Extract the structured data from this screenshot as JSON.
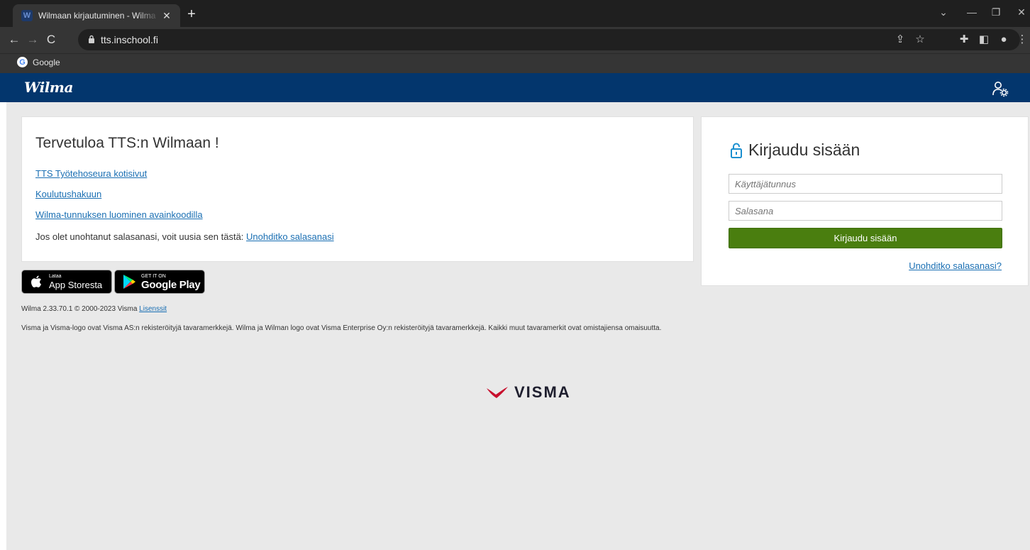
{
  "browser": {
    "tab_title": "Wilmaan kirjautuminen - Wilma",
    "tab_favicon": "W",
    "url": "tts.inschool.fi",
    "bookmark_label": "Google"
  },
  "wilma": {
    "logo": "Wilma",
    "header_color": "#03366d"
  },
  "welcome": {
    "title": "Tervetuloa TTS:n Wilmaan !",
    "links": [
      "TTS Työtehoseura kotisivut",
      "Koulutushakuun",
      "Wilma-tunnuksen luominen avainkoodilla"
    ],
    "forgot_text": "Jos olet unohtanut salasanasi, voit uusia sen tästä:",
    "forgot_link": "Unohditko salasanasi"
  },
  "badges": {
    "apple_small": "Lataa",
    "apple_big": "App Storesta",
    "google_small": "GET IT ON",
    "google_big": "Google Play"
  },
  "footer": {
    "version": "Wilma 2.33.70.1 © 2000-2023 Visma",
    "licenses": "Lisenssit",
    "trademark": "Visma ja Visma-logo ovat Visma AS:n rekisteröityjä tavaramerkkejä. Wilma ja Wilman logo ovat Visma Enterprise Oy:n rekisteröityjä tavaramerkkejä. Kaikki muut tavaramerkit ovat omistajiensa omaisuutta.",
    "visma_logo": "VISMA",
    "visma_color": "#c8102e"
  },
  "login": {
    "title": "Kirjaudu sisään",
    "username_placeholder": "Käyttäjätunnus",
    "password_placeholder": "Salasana",
    "submit": "Kirjaudu sisään",
    "forgot": "Unohditko salasanasi?",
    "button_color": "#4a7e0f",
    "lock_color": "#1a8fd0"
  }
}
